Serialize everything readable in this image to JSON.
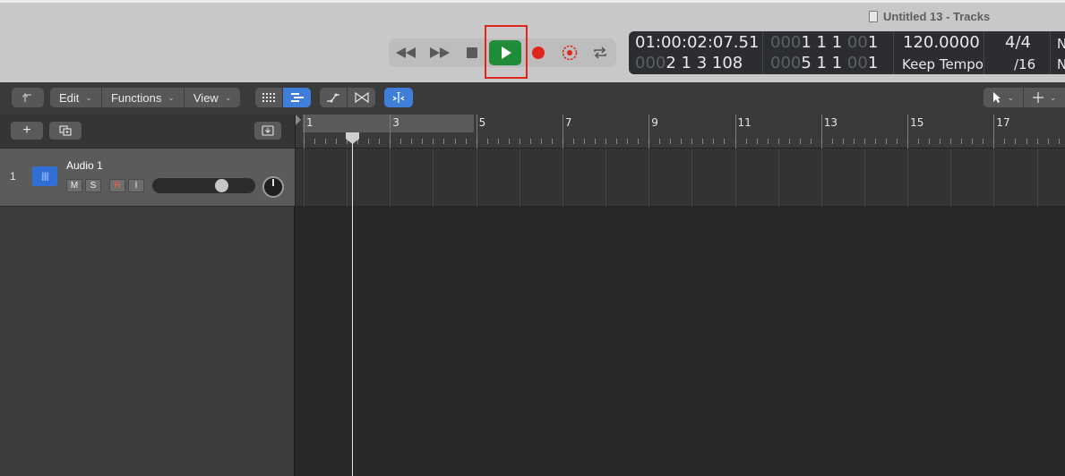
{
  "window": {
    "title": "Untitled 13 - Tracks"
  },
  "transport": {
    "buttons": [
      "rewind",
      "fast-forward",
      "stop",
      "play",
      "record",
      "capture-recording",
      "cycle"
    ],
    "highlighted": "play",
    "colors": {
      "play": "#1f8c37",
      "record": "#e0261c",
      "highlight": "#e0261c"
    }
  },
  "lcd": {
    "smpte": "01:00:02:07.51",
    "bars_beats": "2 1 3 108",
    "bars_beats_dim": "000",
    "locator_left_dim": "000",
    "locator_left": "1 1 1",
    "locator_left_dim2": "00",
    "locator_left_end": "1",
    "locator_right_dim": "000",
    "locator_right": "5 1 1",
    "locator_right_dim2": "00",
    "locator_right_end": "1",
    "tempo": "120.0000",
    "tempo_mode": "Keep Tempo",
    "time_signature": "4/4",
    "division": "/16",
    "key_edge_top": "N",
    "key_edge_bottom": "N"
  },
  "toolbar": {
    "back_icon": "up-arrow-icon",
    "menus": [
      "Edit",
      "Functions",
      "View"
    ],
    "view_buttons": [
      "grid-view-icon",
      "list-view-icon"
    ],
    "automation_icon": "automation-curve-icon",
    "flex_icon": "flex-icon",
    "catch_icon": "catch-playhead-icon",
    "pointer_tool": "pointer-tool-icon",
    "pencil_tool": "crosshair-tool-icon"
  },
  "track_header": {
    "add_icon": "plus-icon",
    "duplicate_icon": "duplicate-track-icon",
    "download_icon": "download-icon"
  },
  "tracks": [
    {
      "number": "1",
      "name": "Audio 1",
      "buttons": [
        "M",
        "S",
        "R",
        "I"
      ],
      "volume": 0.7,
      "pan": 0
    }
  ],
  "ruler": {
    "bars": [
      "1",
      "3",
      "5",
      "7",
      "9",
      "11",
      "13",
      "15",
      "17"
    ],
    "cycle_start": "1",
    "cycle_end": "5"
  },
  "playhead": {
    "bars_beats": "2 1 3 108"
  }
}
